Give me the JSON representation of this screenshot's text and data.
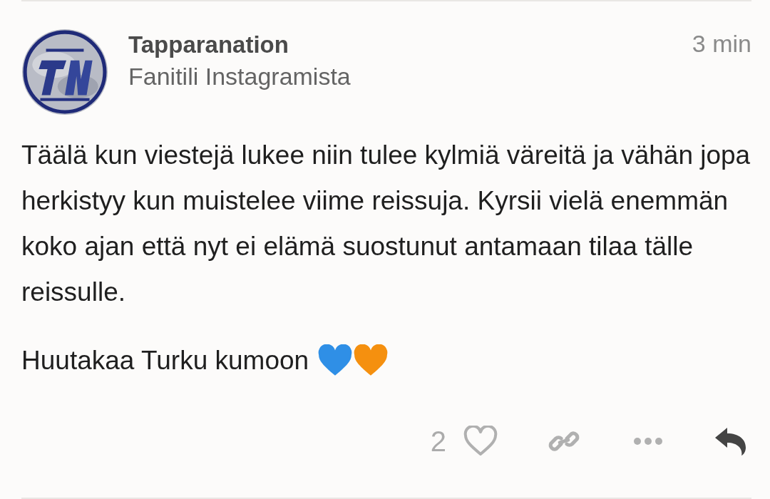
{
  "post": {
    "author": "Tapparanation",
    "subtitle": "Fanitili Instagramista",
    "time": "3 min",
    "paragraphs": [
      "Täälä kun viestejä lukee niin tulee kylmiä väreitä ja vähän jopa herkistyy kun muistelee viime reissuja. Kyrsii vielä enemmän koko ajan että nyt ei elämä suostunut antamaan tilaa tälle reissulle.",
      "Huutakaa Turku kumoon"
    ],
    "emoji_hearts": [
      {
        "color": "#2f8fe6"
      },
      {
        "color": "#f5900f"
      }
    ],
    "actions": {
      "like_count": "2",
      "liked": false
    }
  }
}
